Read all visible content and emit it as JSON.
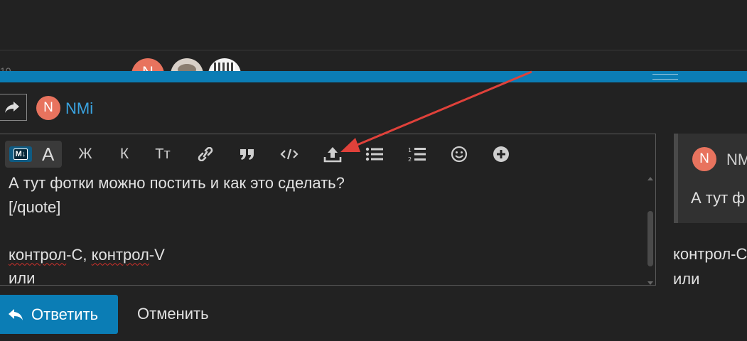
{
  "background_topic": {
    "stray_count": "10",
    "participant_avatar_letter": "N"
  },
  "composer": {
    "user": {
      "avatar_letter": "N",
      "name": "NMi"
    },
    "toolbar": {
      "markdown_badge": "M↓",
      "rich_text_label": "A",
      "bold_label": "Ж",
      "italic_label": "К",
      "heading_label": "Тт",
      "buttons": [
        "link-icon",
        "quote-icon",
        "code-icon",
        "upload-icon",
        "bullet-list-icon",
        "numbered-list-icon",
        "emoji-icon",
        "plus-icon"
      ]
    },
    "editor_lines": [
      "А тут фотки можно постить и как это сделать?",
      "[/quote]",
      "",
      "контрол-С, контрол-V",
      "или"
    ],
    "spellcheck_words": [
      "контрол",
      "контрол"
    ],
    "reply_button_label": "Ответить",
    "cancel_label": "Отменить"
  },
  "preview": {
    "quote_avatar_letter": "N",
    "quote_name": "NM",
    "quote_text": "А тут ф",
    "line1": "контрол-С",
    "line2": "или"
  },
  "colors": {
    "accent": "#0b7db5",
    "username": "#3aa3e0",
    "avatar": "#e8735e",
    "annotation_arrow": "#e0413a"
  }
}
